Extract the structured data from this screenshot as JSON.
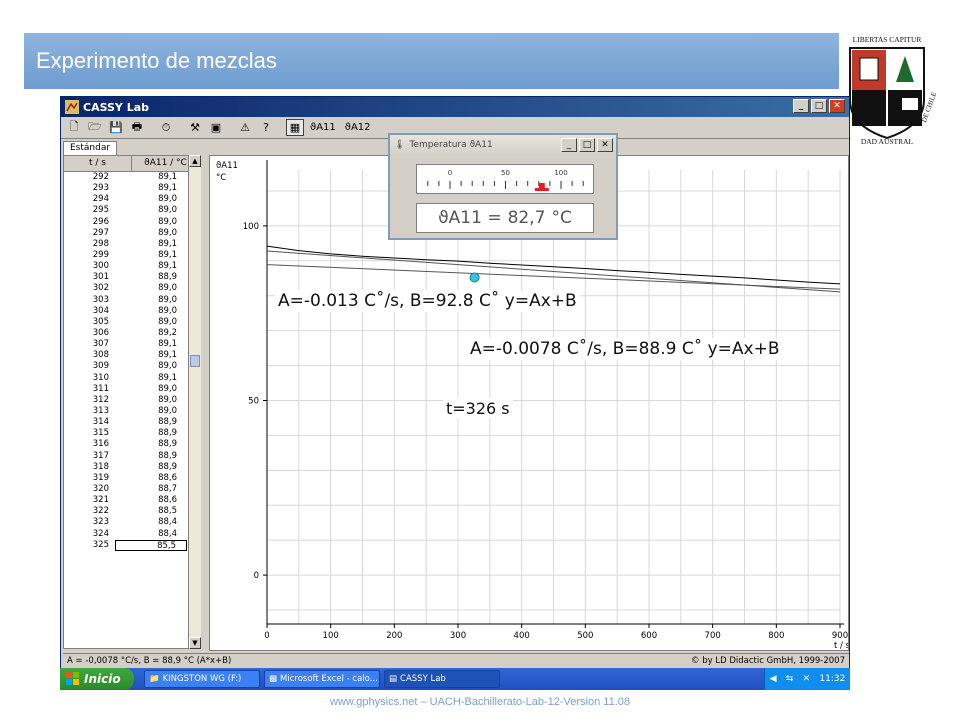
{
  "slide": {
    "title": "Experimento de mezclas",
    "footer": "www.gphysics.net – UACH-Bachillerato-Lab-12-Version 11.08",
    "seal": {
      "top_text": "LIBERTAS CAPITUR",
      "bottom_text": "DAD AUSTRAL",
      "side_text": "DE CHILE"
    }
  },
  "window": {
    "title": "CASSY Lab",
    "controls": [
      "_",
      "□",
      "✕"
    ],
    "toolbar": {
      "sensor1": "ϑA11",
      "sensor2": "ϑA12"
    },
    "tab": "Estándar"
  },
  "table": {
    "headers": [
      "t / s",
      "ϑA11 / °C"
    ],
    "rows": [
      [
        "292",
        "89,1"
      ],
      [
        "293",
        "89,1"
      ],
      [
        "294",
        "89,0"
      ],
      [
        "295",
        "89,0"
      ],
      [
        "296",
        "89,0"
      ],
      [
        "297",
        "89,0"
      ],
      [
        "298",
        "89,1"
      ],
      [
        "299",
        "89,1"
      ],
      [
        "300",
        "89,1"
      ],
      [
        "301",
        "88,9"
      ],
      [
        "302",
        "89,0"
      ],
      [
        "303",
        "89,0"
      ],
      [
        "304",
        "89,0"
      ],
      [
        "305",
        "89,0"
      ],
      [
        "306",
        "89,2"
      ],
      [
        "307",
        "89,1"
      ],
      [
        "308",
        "89,1"
      ],
      [
        "309",
        "89,0"
      ],
      [
        "310",
        "89,1"
      ],
      [
        "311",
        "89,0"
      ],
      [
        "312",
        "89,0"
      ],
      [
        "313",
        "89,0"
      ],
      [
        "314",
        "88,9"
      ],
      [
        "315",
        "88,9"
      ],
      [
        "316",
        "88,9"
      ],
      [
        "317",
        "88,9"
      ],
      [
        "318",
        "88,9"
      ],
      [
        "319",
        "88,6"
      ],
      [
        "320",
        "88,7"
      ],
      [
        "321",
        "88,6"
      ],
      [
        "322",
        "88,5"
      ],
      [
        "323",
        "88,4"
      ],
      [
        "324",
        "88,4"
      ],
      [
        "325",
        "85,5"
      ]
    ]
  },
  "chart_data": {
    "type": "line",
    "ylabel_top": "ϑA11",
    "yunit": "°C",
    "xlabel": "t / s",
    "xlim": [
      0,
      900
    ],
    "ylim": [
      -14,
      116
    ],
    "xticks": [
      0,
      100,
      200,
      300,
      400,
      500,
      600,
      700,
      800,
      900
    ],
    "yticks": [
      0,
      50,
      100
    ],
    "grid": true,
    "series": [
      {
        "x": [
          0,
          50,
          100,
          150,
          200,
          250,
          300,
          350,
          400,
          450,
          500,
          550,
          600,
          650,
          700,
          750,
          800,
          850,
          900
        ],
        "y": [
          94.2,
          92.9,
          92.0,
          91.3,
          90.8,
          90.3,
          89.9,
          89.3,
          88.8,
          88.3,
          87.8,
          87.2,
          86.7,
          86.1,
          85.6,
          85.1,
          84.5,
          83.9,
          83.4
        ]
      }
    ],
    "fits": [
      {
        "A": -0.013,
        "B": 92.8,
        "x": [
          0,
          900
        ]
      },
      {
        "A": -0.0078,
        "B": 88.9,
        "x": [
          0,
          900
        ]
      }
    ],
    "marker": {
      "x": 326
    }
  },
  "annotations": {
    "fit1": "A=-0.013 C˚/s, B=92.8 C˚ y=Ax+B",
    "fit2": "A=-0.0078 C˚/s, B=88.9 C˚ y=Ax+B",
    "time": "t=326 s"
  },
  "popup": {
    "title": "Temperatura ϑA11",
    "scale_labels": [
      "0",
      "50",
      "100"
    ],
    "value": 82.7,
    "reading_label": "ϑA11 =",
    "reading_value": "82,7",
    "reading_unit": "°C"
  },
  "status": {
    "left": "A = -0,0078 °C/s,  B = 88,9 °C  (A*x+B)",
    "right": "© by LD Didactic GmbH, 1999-2007"
  },
  "taskbar": {
    "start": "Inicio",
    "tasks": [
      "KINGSTON WG (F:)",
      "Microsoft Excel - calo...",
      "CASSY Lab"
    ],
    "clock": "11:32"
  }
}
